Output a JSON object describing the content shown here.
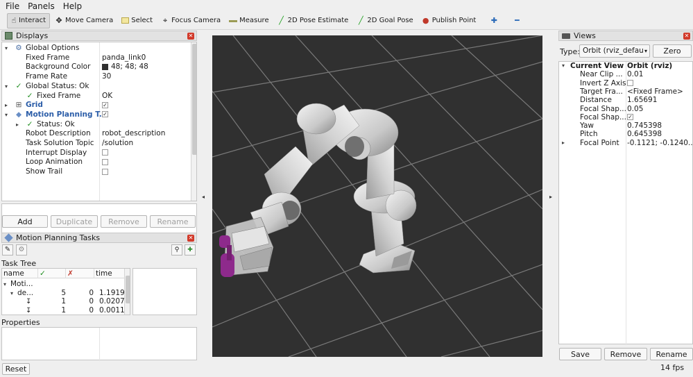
{
  "menu": [
    "File",
    "Panels",
    "Help"
  ],
  "toolbar": [
    {
      "label": "Interact",
      "icon": "interact-icon",
      "active": true
    },
    {
      "label": "Move Camera",
      "icon": "move-camera-icon"
    },
    {
      "label": "Select",
      "icon": "select-icon"
    },
    {
      "label": "Focus Camera",
      "icon": "focus-camera-icon"
    },
    {
      "label": "Measure",
      "icon": "measure-icon"
    },
    {
      "label": "2D Pose Estimate",
      "icon": "pose-estimate-icon"
    },
    {
      "label": "2D Goal Pose",
      "icon": "goal-pose-icon"
    },
    {
      "label": "Publish Point",
      "icon": "publish-point-icon"
    }
  ],
  "displays": {
    "title": "Displays",
    "rows": [
      {
        "indent": 0,
        "expander": "down",
        "icon": "globe",
        "label": "Global Options",
        "value": ""
      },
      {
        "indent": 1,
        "label": "Fixed Frame",
        "value": "panda_link0"
      },
      {
        "indent": 1,
        "label": "Background Color",
        "value": "48; 48; 48",
        "swatch": "#303030"
      },
      {
        "indent": 1,
        "label": "Frame Rate",
        "value": "30"
      },
      {
        "indent": 0,
        "expander": "down",
        "icon": "check",
        "label": "Global Status: Ok",
        "value": ""
      },
      {
        "indent": 1,
        "icon": "check",
        "label": "Fixed Frame",
        "value": "OK"
      },
      {
        "indent": 0,
        "expander": "right",
        "icon": "grid",
        "label": "Grid",
        "value": "",
        "checkbox": true,
        "style": "blue"
      },
      {
        "indent": 0,
        "expander": "down",
        "icon": "mp",
        "label": "Motion Planning T...",
        "value": "",
        "checkbox": true,
        "style": "blue"
      },
      {
        "indent": 1,
        "expander": "right",
        "icon": "check",
        "label": "Status: Ok",
        "value": ""
      },
      {
        "indent": 1,
        "label": "Robot Description",
        "value": "robot_description"
      },
      {
        "indent": 1,
        "label": "Task Solution Topic",
        "value": "/solution"
      },
      {
        "indent": 1,
        "label": "Interrupt Display",
        "value": "",
        "checkbox": false
      },
      {
        "indent": 1,
        "label": "Loop Animation",
        "value": "",
        "checkbox": false
      },
      {
        "indent": 1,
        "label": "Show Trail",
        "value": "",
        "checkbox": false
      }
    ],
    "buttons": {
      "add": "Add",
      "duplicate": "Duplicate",
      "remove": "Remove",
      "rename": "Rename"
    }
  },
  "mpt": {
    "title": "Motion Planning Tasks",
    "task_tree_label": "Task Tree",
    "columns": [
      "name",
      "✓",
      "✗",
      "time"
    ],
    "rows": [
      {
        "name": "Moti...",
        "ok": "",
        "fail": "",
        "time": "",
        "level": 0
      },
      {
        "name": "de...",
        "ok": "5",
        "fail": "0",
        "time": "1.1919",
        "level": 1
      },
      {
        "name": "",
        "ok": "1",
        "fail": "0",
        "time": "0.0207",
        "level": 2
      },
      {
        "name": "",
        "ok": "1",
        "fail": "0",
        "time": "0.0011",
        "level": 2
      }
    ],
    "properties_label": "Properties",
    "reset": "Reset"
  },
  "views": {
    "title": "Views",
    "type_label": "Type:",
    "type_value": "Orbit (rviz_defau",
    "zero": "Zero",
    "rows": [
      {
        "label": "Current View",
        "value": "Orbit (rviz)",
        "bold": true,
        "expander": "down"
      },
      {
        "label": "Near Clip ...",
        "value": "0.01"
      },
      {
        "label": "Invert Z Axis",
        "value": "",
        "checkbox": false
      },
      {
        "label": "Target Fra...",
        "value": "<Fixed Frame>"
      },
      {
        "label": "Distance",
        "value": "1.65691"
      },
      {
        "label": "Focal Shap...",
        "value": "0.05"
      },
      {
        "label": "Focal Shap...",
        "value": "",
        "checkbox": true
      },
      {
        "label": "Yaw",
        "value": "0.745398"
      },
      {
        "label": "Pitch",
        "value": "0.645398"
      },
      {
        "label": "Focal Point",
        "value": "-0.1121; -0.1240...",
        "expander": "right"
      }
    ],
    "buttons": {
      "save": "Save",
      "remove": "Remove",
      "rename": "Rename"
    }
  },
  "fps": "14 fps",
  "colors": {
    "viewport_bg": "#303030",
    "grid": "#7a7a7a",
    "gripper": "#8e2a8c",
    "ok_green": "#1c8c1c",
    "link_blue": "#2b5da8"
  }
}
